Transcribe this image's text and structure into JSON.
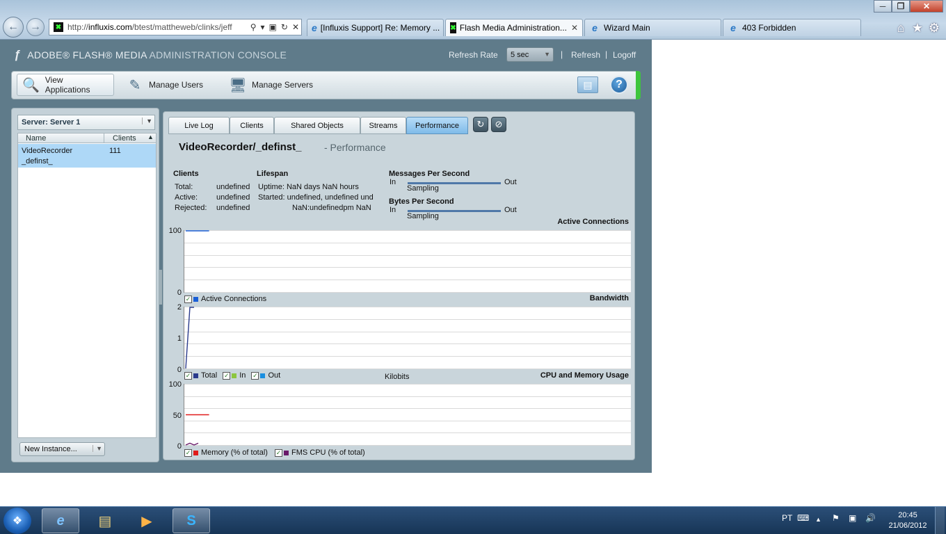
{
  "browser": {
    "address_prefix": "http://",
    "address_domain": "influxis.com",
    "address_path": "/btest/mattheweb/clinks/jeff",
    "tabs": [
      {
        "label": "[Influxis Support] Re: Memory ..."
      },
      {
        "label": "Flash Media Administration..."
      },
      {
        "label": "Wizard Main"
      },
      {
        "label": "403 Forbidden"
      }
    ]
  },
  "header": {
    "brand_main": "ADOBE® FLASH® MEDIA",
    "brand_sub": "ADMINISTRATION CONSOLE",
    "refresh_rate_label": "Refresh Rate",
    "refresh_rate_value": "5 sec",
    "refresh_link": "Refresh",
    "logoff_link": "Logoff"
  },
  "nav": {
    "view_applications": "View Applications",
    "manage_users": "Manage Users",
    "manage_servers": "Manage Servers"
  },
  "left": {
    "server_label": "Server: Server 1",
    "col_name": "Name",
    "col_clients": "Clients",
    "app_name": "VideoRecorder",
    "app_instance": "_definst_",
    "app_clients": "111",
    "new_instance": "New Instance..."
  },
  "tabs": {
    "live_log": "Live Log",
    "clients": "Clients",
    "shared_objects": "Shared Objects",
    "streams": "Streams",
    "performance": "Performance"
  },
  "page": {
    "title": "VideoRecorder/_definst_",
    "subtitle": "- Performance"
  },
  "stats": {
    "clients_title": "Clients",
    "lifespan_title": "Lifespan",
    "total_label": "Total:",
    "total_value": "undefined",
    "active_label": "Active:",
    "active_value": "undefined",
    "rejected_label": "Rejected:",
    "rejected_value": "undefined",
    "uptime": "Uptime: NaN days NaN hours",
    "started": "Started: undefined, undefined und",
    "started_line2": "NaN:undefinedpm NaN",
    "mps_title": "Messages Per Second",
    "bps_title": "Bytes Per Second",
    "in_label": "In",
    "out_label": "Out",
    "sampling": "Sampling"
  },
  "charts": {
    "active_title": "Active Connections",
    "active_y_max": "100",
    "active_y_min": "0",
    "active_legend": "Active Connections",
    "bw_title": "Bandwidth",
    "bw_y_max": "2",
    "bw_y_mid": "1",
    "bw_y_min": "0",
    "bw_legend_total": "Total",
    "bw_legend_in": "In",
    "bw_legend_out": "Out",
    "bw_unit": "Kilobits",
    "cpu_title": "CPU and Memory Usage",
    "cpu_y_max": "100",
    "cpu_y_mid": "50",
    "cpu_y_min": "0",
    "cpu_legend_memory": "Memory (% of total)",
    "cpu_legend_fms": "FMS CPU (% of total)"
  },
  "chart_data": [
    {
      "type": "line",
      "title": "Active Connections",
      "ylim": [
        0,
        100
      ],
      "series": [
        {
          "name": "Active Connections",
          "values": [
            100,
            100
          ]
        }
      ]
    },
    {
      "type": "line",
      "title": "Bandwidth",
      "ylabel": "Kilobits",
      "ylim": [
        0,
        2
      ],
      "series": [
        {
          "name": "Total",
          "values": [
            0,
            2,
            2
          ]
        },
        {
          "name": "In",
          "values": []
        },
        {
          "name": "Out",
          "values": []
        }
      ]
    },
    {
      "type": "line",
      "title": "CPU and Memory Usage",
      "ylim": [
        0,
        100
      ],
      "series": [
        {
          "name": "Memory (% of total)",
          "values": [
            50,
            50
          ]
        },
        {
          "name": "FMS CPU (% of total)",
          "values": [
            0,
            3,
            0,
            3
          ]
        }
      ]
    }
  ],
  "taskbar": {
    "lang": "PT",
    "time": "20:45",
    "date": "21/06/2012"
  },
  "colors": {
    "accent_blue": "#1a5fd6",
    "memory_red": "#e01b1b",
    "cpu_purple": "#6a1a6a",
    "green_accent": "#3ec53c"
  }
}
